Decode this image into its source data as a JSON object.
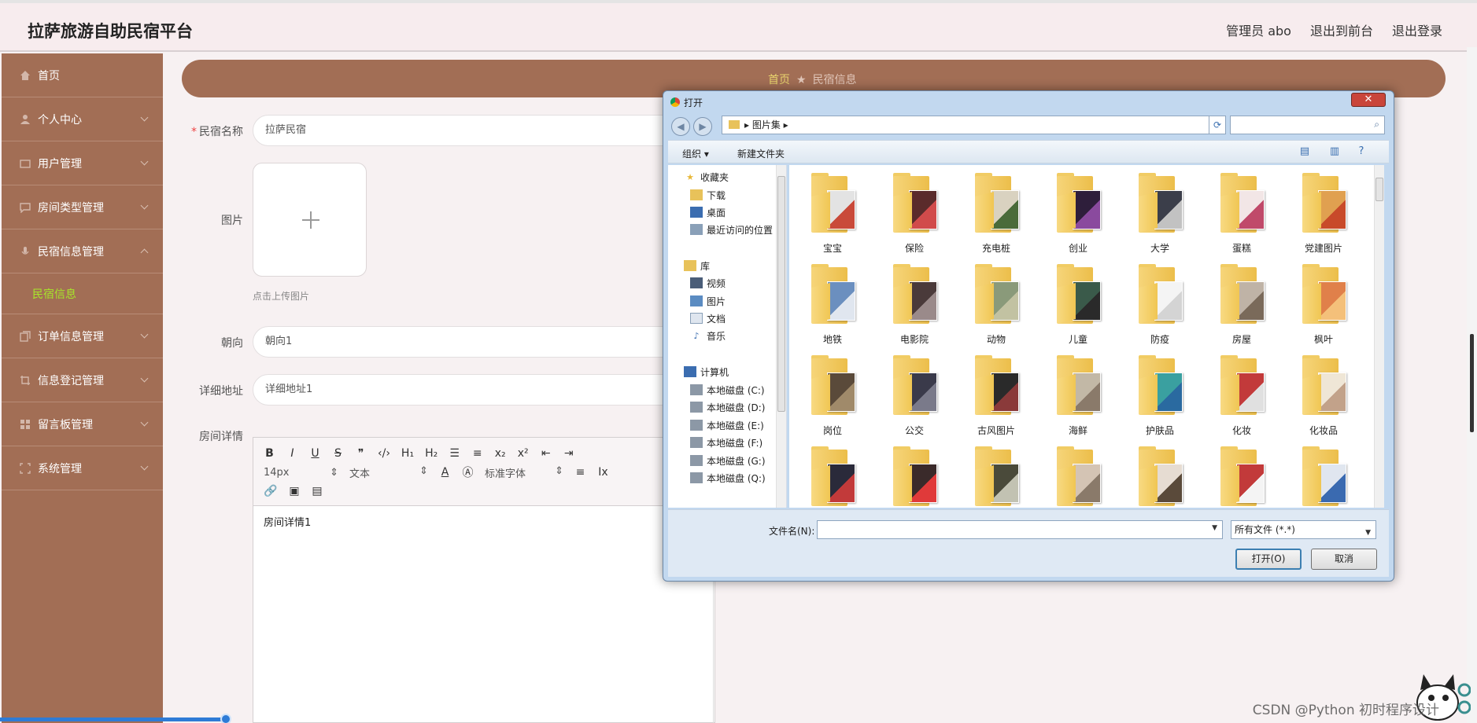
{
  "app": {
    "title": "拉萨旅游自助民宿平台",
    "top_links": [
      "管理员 abo",
      "退出到前台",
      "退出登录"
    ]
  },
  "sidebar": {
    "items": [
      {
        "label": "首页",
        "icon": "home-icon"
      },
      {
        "label": "个人中心",
        "icon": "user-icon"
      },
      {
        "label": "用户管理",
        "icon": "users-icon"
      },
      {
        "label": "房间类型管理",
        "icon": "chat-icon"
      },
      {
        "label": "民宿信息管理",
        "icon": "mic-icon"
      },
      {
        "label": "订单信息管理",
        "icon": "copy-icon"
      },
      {
        "label": "信息登记管理",
        "icon": "crop-icon"
      },
      {
        "label": "留言板管理",
        "icon": "grid-icon"
      },
      {
        "label": "系统管理",
        "icon": "frame-icon"
      }
    ],
    "active_sub": "民宿信息"
  },
  "breadcrumb": {
    "home": "首页",
    "current": "民宿信息"
  },
  "form": {
    "name_label": "民宿名称",
    "name_value": "拉萨民宿",
    "image_label": "图片",
    "upload_tip": "点击上传图片",
    "orientation_label": "朝向",
    "orientation_value": "朝向1",
    "address_label": "详细地址",
    "address_value": "详细地址1",
    "details_label": "房间详情",
    "editor": {
      "font_size": "14px",
      "block_type": "文本",
      "font_family": "标准字体",
      "content": "房间详情1"
    }
  },
  "dialog": {
    "title": "打开",
    "path": "图片集",
    "commands": [
      "组织 ▾",
      "新建文件夹"
    ],
    "nav": {
      "favorites": "收藏夹",
      "favorites_items": [
        "下载",
        "桌面",
        "最近访问的位置"
      ],
      "library": "库",
      "library_items": [
        "视频",
        "图片",
        "文档",
        "音乐"
      ],
      "computer": "计算机",
      "drives": [
        "本地磁盘 (C:)",
        "本地磁盘 (D:)",
        "本地磁盘 (E:)",
        "本地磁盘 (F:)",
        "本地磁盘 (G:)",
        "本地磁盘 (Q:)"
      ]
    },
    "folders": [
      "宝宝",
      "保险",
      "充电桩",
      "创业",
      "大学",
      "蛋糕",
      "党建图片",
      "地铁",
      "电影院",
      "动物",
      "儿童",
      "防疫",
      "房屋",
      "枫叶",
      "岗位",
      "公交",
      "古风图片",
      "海鲜",
      "护肤品",
      "化妆",
      "化妆品",
      "",
      "",
      "",
      "",
      "",
      "",
      ""
    ],
    "filename_label": "文件名(N):",
    "filetype": "所有文件 (*.*)",
    "open_button": "打开(O)",
    "cancel_button": "取消",
    "close_glyph": "✕"
  },
  "watermark": "CSDN @Python 初时程序设计",
  "colors": {
    "sidebar": "#a26e55",
    "accent": "#a7e62a",
    "breadcrumb_home": "#e8d36d"
  }
}
